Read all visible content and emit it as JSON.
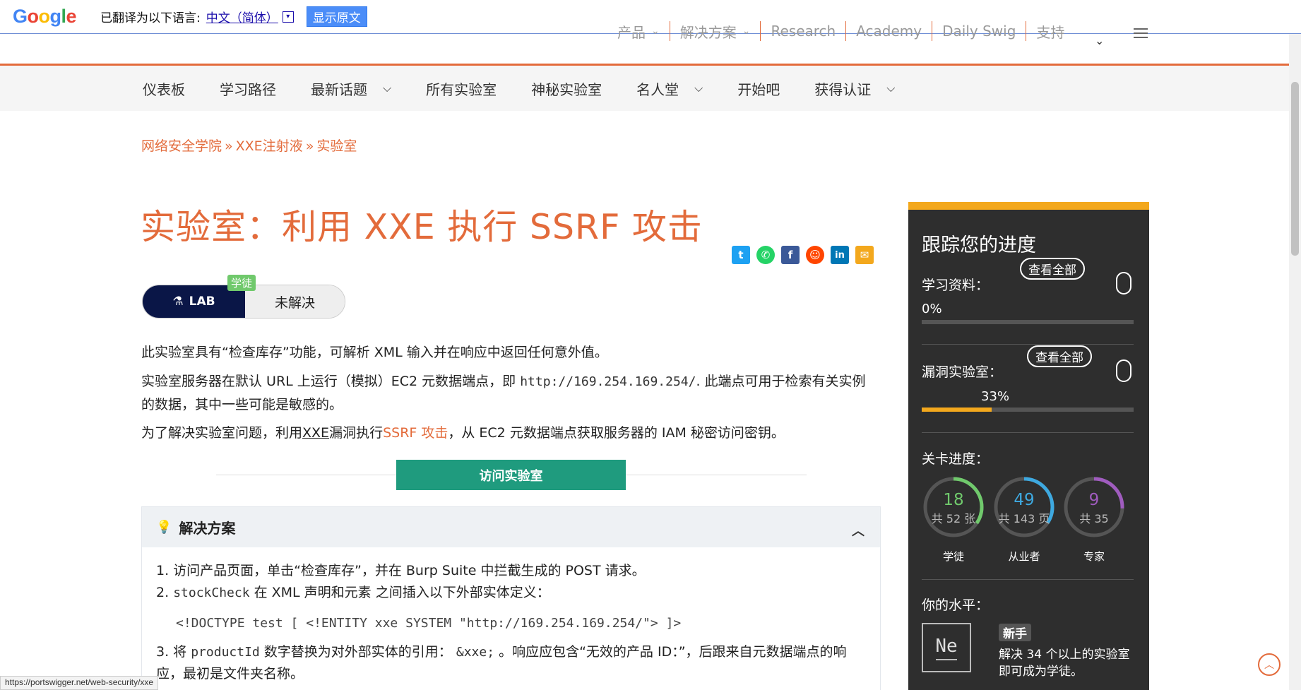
{
  "translate_bar": {
    "logo": [
      "G",
      "o",
      "o",
      "g",
      "l",
      "e"
    ],
    "translated_to_label": "已翻译为以下语言:",
    "language": "中文（简体）",
    "dropdown_glyph": "▾",
    "show_original": "显示原文"
  },
  "top_nav": {
    "items": [
      "产品",
      "解决方案",
      "Research",
      "Academy",
      "Daily Swig",
      "支持"
    ],
    "chevron": "⌄"
  },
  "sub_nav": {
    "items": [
      {
        "label": "仪表板",
        "dropdown": false
      },
      {
        "label": "学习路径",
        "dropdown": false
      },
      {
        "label": "最新话题",
        "dropdown": true
      },
      {
        "label": "所有实验室",
        "dropdown": false
      },
      {
        "label": "神秘实验室",
        "dropdown": false
      },
      {
        "label": "名人堂",
        "dropdown": true
      },
      {
        "label": "开始吧",
        "dropdown": false
      },
      {
        "label": "获得认证",
        "dropdown": true
      }
    ],
    "chevron": "⌵"
  },
  "breadcrumb": {
    "items": [
      "网络安全学院",
      "XXE注射液",
      "实验室"
    ],
    "separator": "»"
  },
  "page_title": "实验室：利用 XXE 执行 SSRF 攻击",
  "share_icons": [
    {
      "name": "twitter-icon",
      "glyph": "t",
      "color": "#1da1f2"
    },
    {
      "name": "whatsapp-icon",
      "glyph": "✆",
      "color": "#25d366"
    },
    {
      "name": "facebook-icon",
      "glyph": "f",
      "color": "#3b5998"
    },
    {
      "name": "reddit-icon",
      "glyph": "☺",
      "color": "#ff4500"
    },
    {
      "name": "linkedin-icon",
      "glyph": "in",
      "color": "#0077b5"
    },
    {
      "name": "email-icon",
      "glyph": "✉",
      "color": "#f3a81d"
    }
  ],
  "lab_badge": {
    "lab_label": "LAB",
    "status": "未解决",
    "level": "学徒",
    "flask_glyph": "⚗"
  },
  "description": {
    "p1": "此实验室具有“检查库存”功能，可解析 XML 输入并在响应中返回任何意外值。",
    "p2_before": "实验室服务器在默认 URL 上运行（模拟）EC2 元数据端点，即 ",
    "p2_code": "http://169.254.169.254/",
    "p2_after": ". 此端点可用于检索有关实例的数据，其中一些可能是敏感的。",
    "p3_before": "为了解决实验室问题，利用",
    "p3_link1": "XXE",
    "p3_mid": "漏洞执行",
    "p3_link2": "SSRF 攻击",
    "p3_after": "，从 EC2 元数据端点获取服务器的 IAM 秘密访问密钥。"
  },
  "access_button": "访问实验室",
  "solution": {
    "title": "解决方案",
    "bulb_glyph": "💡",
    "caret_glyph": "︿",
    "step1": "1. 访问产品页面，单击“检查库存”，并在 Burp Suite 中拦截生成的 POST 请求。",
    "step2_num": "2.",
    "step2_code": "stockCheck",
    "step2_text": " 在 XML 声明和元素 之间插入以下外部实体定义：",
    "code_block": "<!DOCTYPE test [ <!ENTITY xxe SYSTEM \"http://169.254.169.254/\"> ]>",
    "step3_before": "3. 将 ",
    "step3_code1": "productId",
    "step3_mid": " 数字替换为对外部实体的引用： ",
    "step3_code2": "&xxe;",
    "step3_after": " 。响应应包含“无效的产品 ID：”，后跟来自元数据端点的响应，最初是文件夹名称。"
  },
  "sidebar": {
    "title": "跟踪您的进度",
    "learning_label": "学习资料：",
    "learning_view_all": "查看全部",
    "learning_pct": "0%",
    "learning_value": 0,
    "labs_label": "漏洞实验室：",
    "labs_view_all": "查看全部",
    "labs_pct": "33%",
    "labs_value": 0.33,
    "level_progress_label": "关卡进度：",
    "rings": [
      {
        "num": "18",
        "sub": "共 52 张",
        "label": "学徒",
        "color": "#70c96c",
        "value": 0.346
      },
      {
        "num": "49",
        "sub": "共 143 页",
        "label": "从业者",
        "color": "#3ea9e0",
        "value": 0.343
      },
      {
        "num": "9",
        "sub": "共 35",
        "label": "专家",
        "color": "#a05cbf",
        "value": 0.257
      }
    ],
    "your_level_label": "你的水平：",
    "element_symbol": "Ne",
    "level_name": "新手",
    "level_desc": "解决 34 个以上的实验室即可成为学徒。"
  },
  "status_url": "https://portswigger.net/web-security/xxe",
  "back_to_top_glyph": "︿"
}
